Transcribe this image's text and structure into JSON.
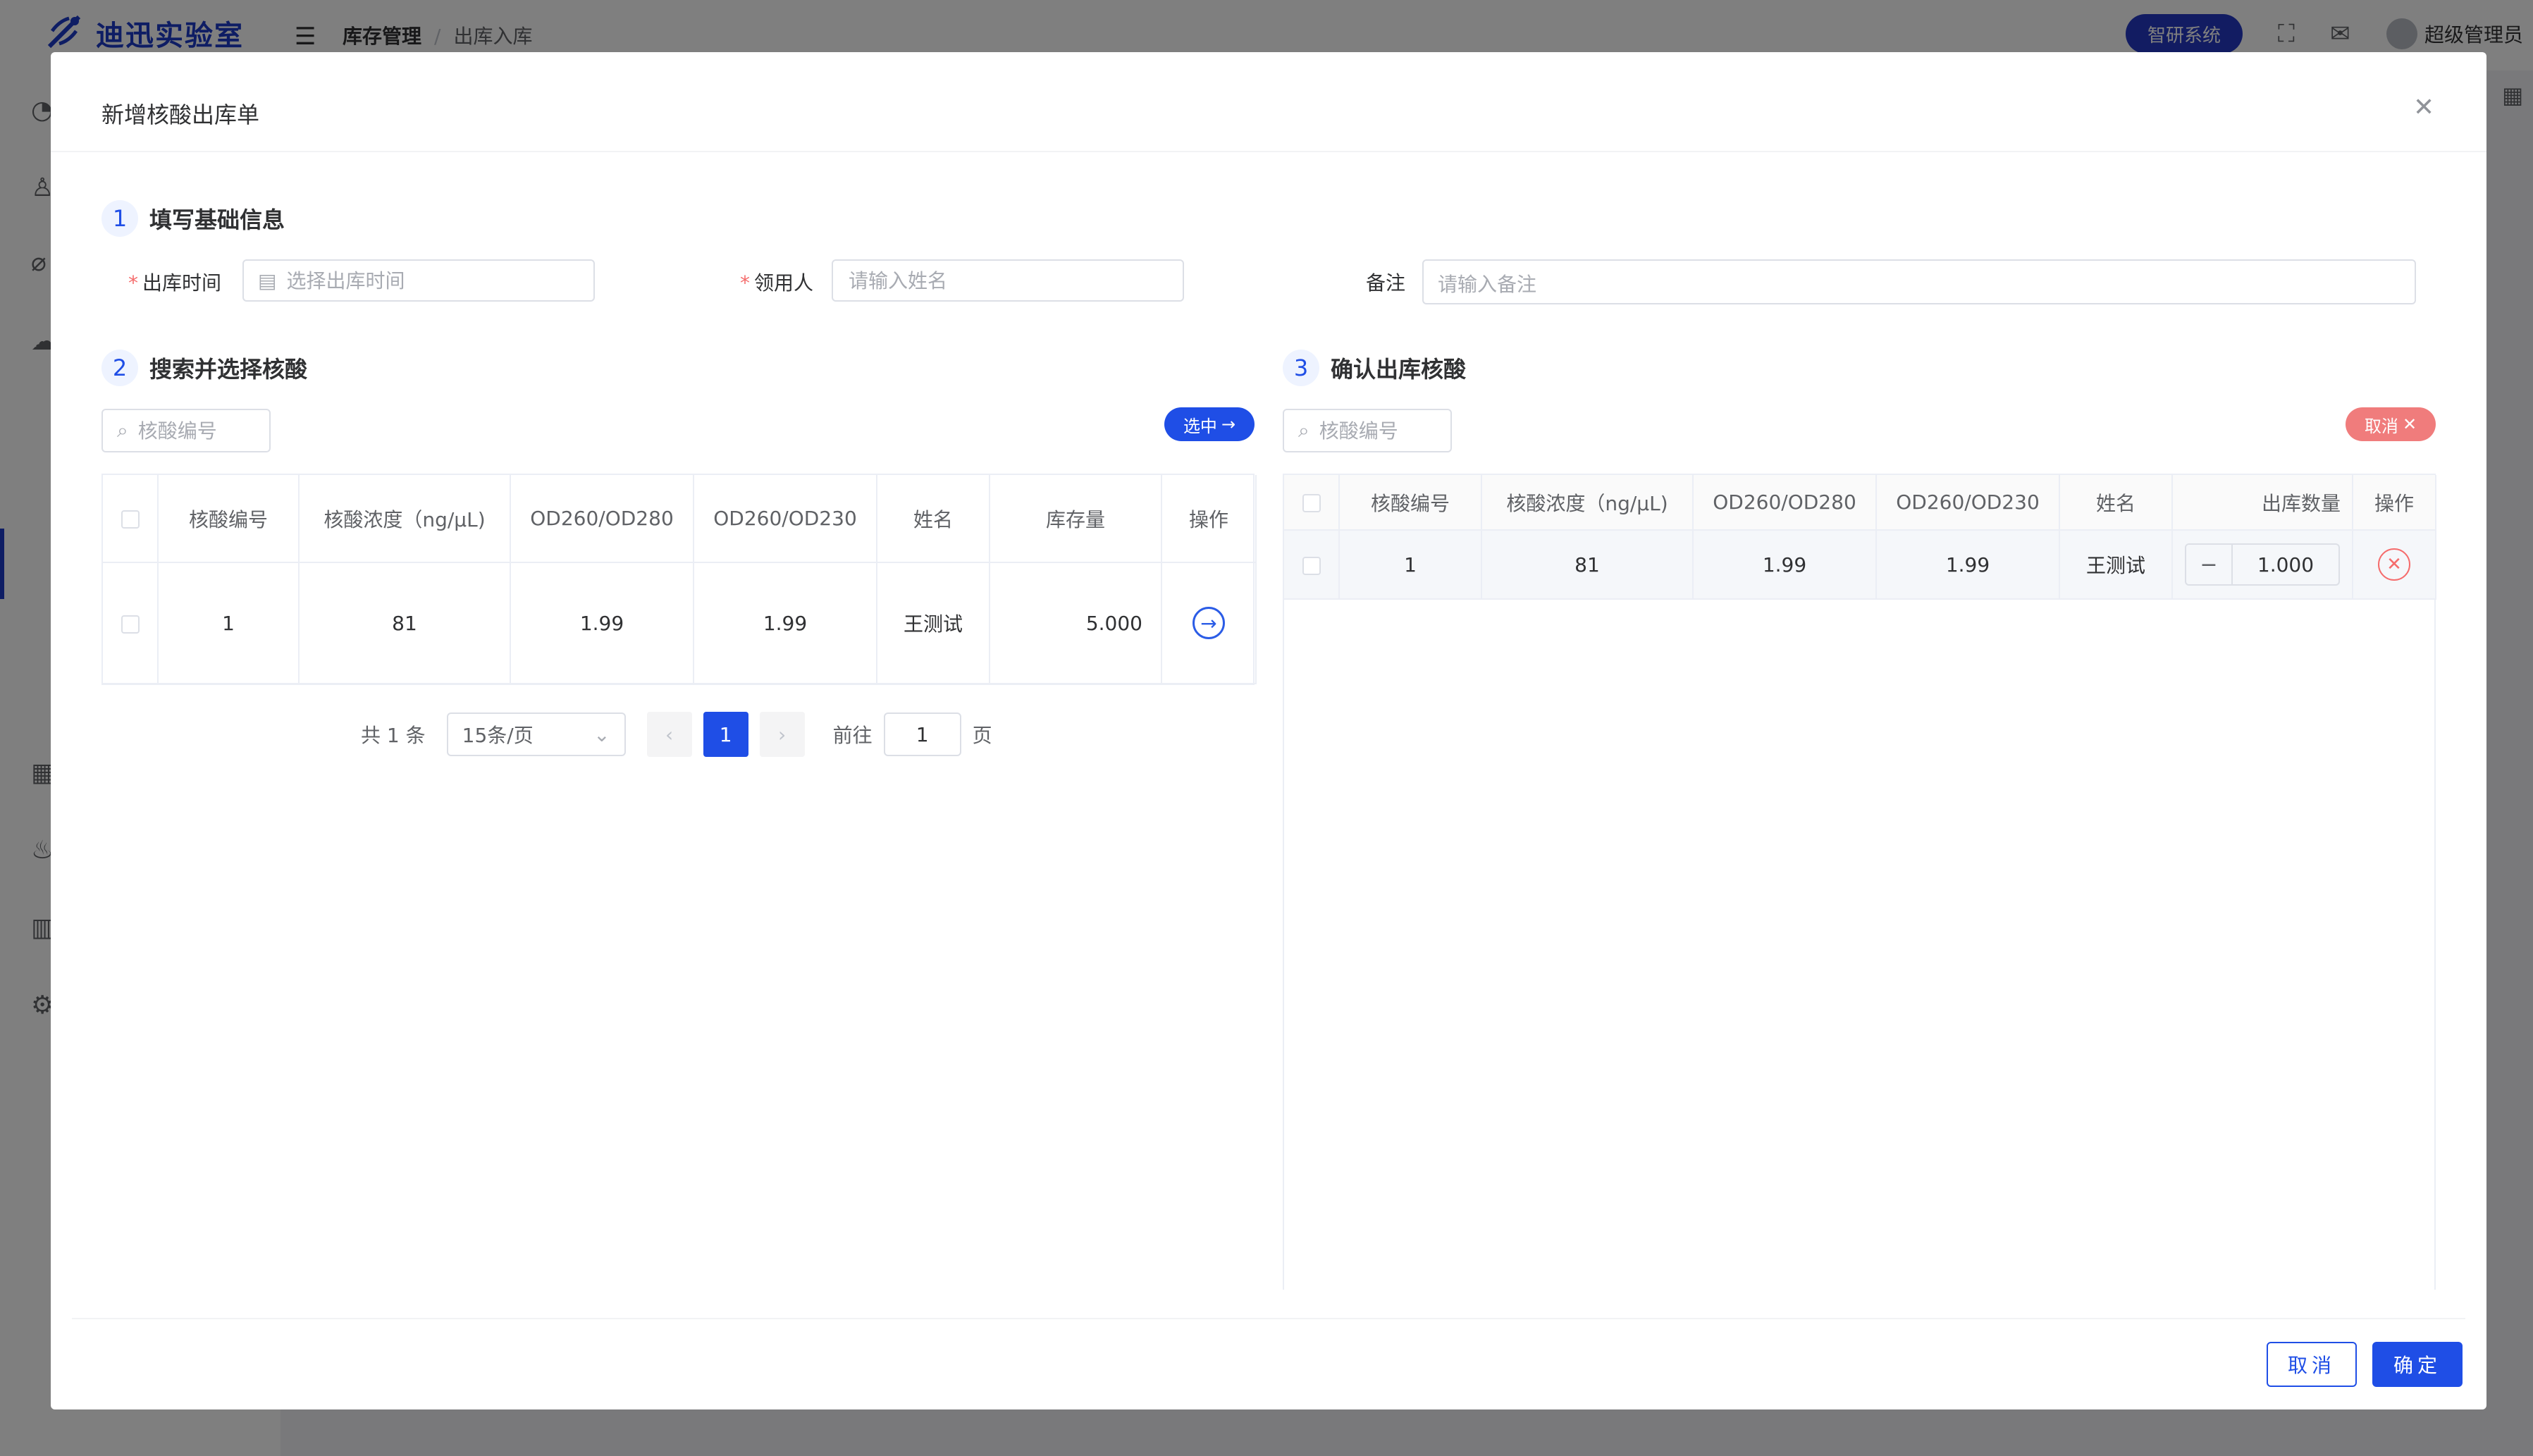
{
  "app": {
    "logo_text": "迪迅实验室",
    "system_button": "智研系统",
    "user_name": "超级管理员"
  },
  "breadcrumb": {
    "first": "库存管理",
    "separator": "/",
    "second": "出库入库"
  },
  "dialog": {
    "title": "新增核酸出库单",
    "step1": {
      "num": "1",
      "title": "填写基础信息"
    },
    "fields": {
      "out_time": {
        "label": "出库时间",
        "placeholder": "选择出库时间"
      },
      "receiver": {
        "label": "领用人",
        "placeholder": "请输入姓名"
      },
      "remark": {
        "label": "备注",
        "placeholder": "请输入备注"
      }
    },
    "step2": {
      "num": "2",
      "title": "搜索并选择核酸",
      "search_placeholder": "核酸编号",
      "select_button": "选中"
    },
    "step3": {
      "num": "3",
      "title": "确认出库核酸",
      "search_placeholder": "核酸编号",
      "cancel_button": "取消"
    },
    "left_table": {
      "headers": [
        "核酸编号",
        "核酸浓度（ng/μL)",
        "OD260/OD280",
        "OD260/OD230",
        "姓名",
        "库存量",
        "操作"
      ],
      "rows": [
        {
          "id": "1",
          "concentration": "81",
          "od280": "1.99",
          "od230": "1.99",
          "name": "王测试",
          "stock": "5.000"
        }
      ]
    },
    "right_table": {
      "headers": [
        "核酸编号",
        "核酸浓度（ng/μL)",
        "OD260/OD280",
        "OD260/OD230",
        "姓名",
        "出库数量",
        "操作"
      ],
      "rows": [
        {
          "id": "1",
          "concentration": "81",
          "od280": "1.99",
          "od230": "1.99",
          "name": "王测试",
          "quantity": "1.000"
        }
      ]
    },
    "pagination": {
      "total": "共 1 条",
      "page_size": "15条/页",
      "current_page": "1",
      "goto_label": "前往",
      "goto_value": "1",
      "page_suffix": "页"
    },
    "footer": {
      "cancel": "取消",
      "confirm": "确定"
    }
  }
}
